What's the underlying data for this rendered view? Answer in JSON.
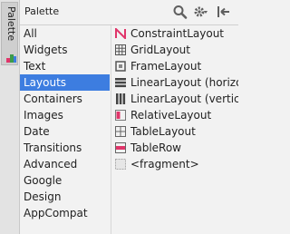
{
  "side_tab": {
    "label": "Palette"
  },
  "header": {
    "title": "Palette"
  },
  "categories": [
    {
      "label": "All"
    },
    {
      "label": "Widgets"
    },
    {
      "label": "Text"
    },
    {
      "label": "Layouts",
      "selected": true
    },
    {
      "label": "Containers"
    },
    {
      "label": "Images"
    },
    {
      "label": "Date"
    },
    {
      "label": "Transitions"
    },
    {
      "label": "Advanced"
    },
    {
      "label": "Google"
    },
    {
      "label": "Design"
    },
    {
      "label": "AppCompat"
    }
  ],
  "items": [
    {
      "label": "ConstraintLayout",
      "icon": "constraint-layout-icon"
    },
    {
      "label": "GridLayout",
      "icon": "grid-layout-icon"
    },
    {
      "label": "FrameLayout",
      "icon": "frame-layout-icon"
    },
    {
      "label": "LinearLayout (horizont",
      "icon": "linear-horizontal-icon"
    },
    {
      "label": "LinearLayout (vertical)",
      "icon": "linear-vertical-icon"
    },
    {
      "label": "RelativeLayout",
      "icon": "relative-layout-icon"
    },
    {
      "label": "TableLayout",
      "icon": "table-layout-icon"
    },
    {
      "label": "TableRow",
      "icon": "table-row-icon"
    },
    {
      "label": "<fragment>",
      "icon": "fragment-icon"
    }
  ],
  "colors": {
    "selection": "#3d7de0",
    "accent_pink": "#e0356a"
  }
}
